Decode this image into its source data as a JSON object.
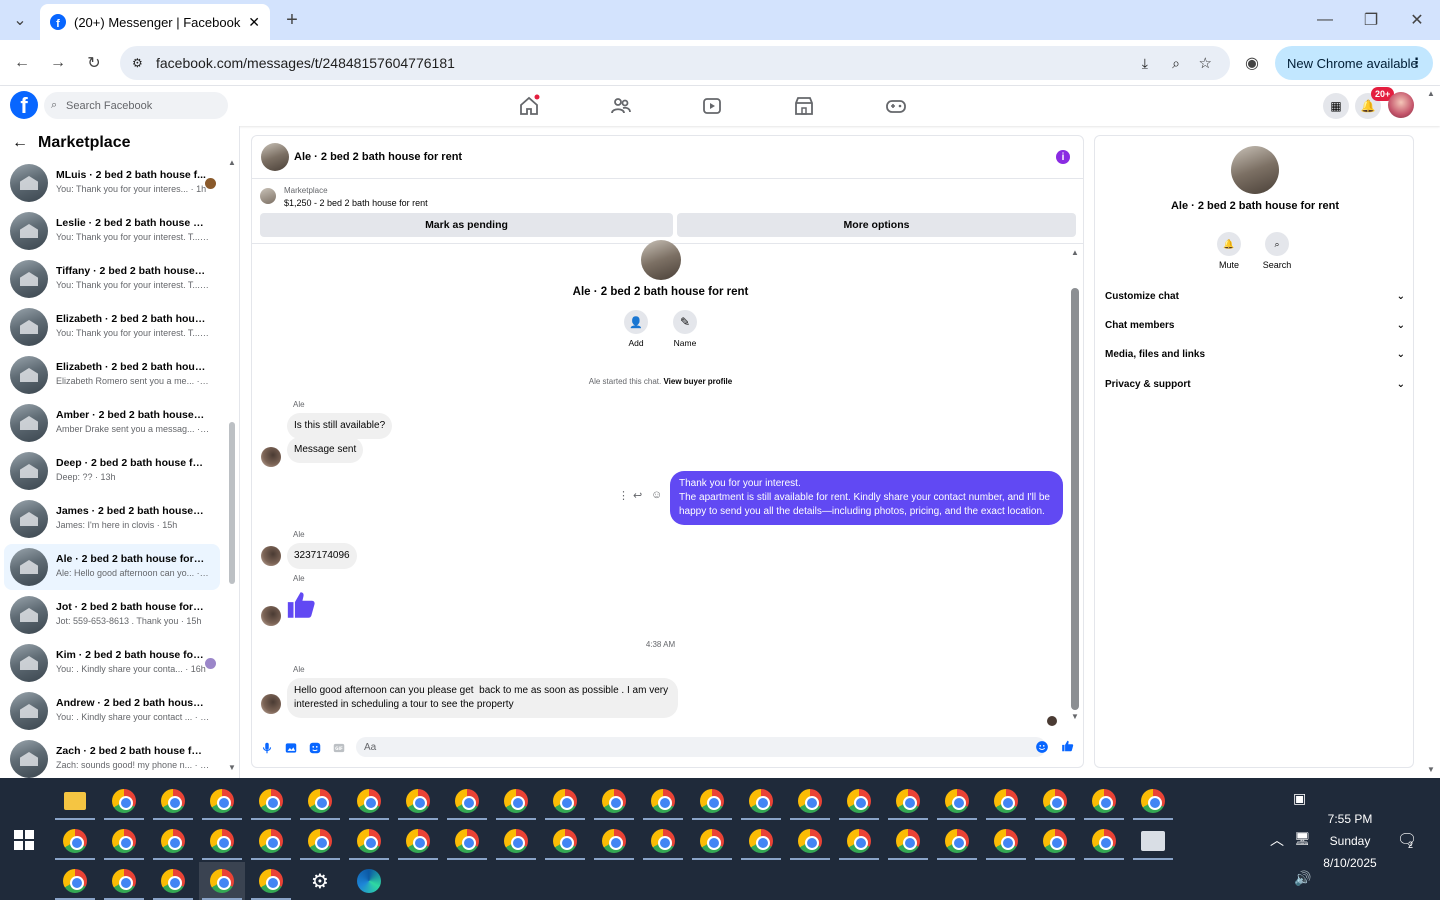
{
  "browser": {
    "tab_title": "(20+) Messenger | Facebook",
    "url": "facebook.com/messages/t/24848157604776181",
    "update_button": "New Chrome available"
  },
  "fb_header": {
    "search_placeholder": "Search Facebook",
    "notifications_badge": "20+",
    "brand_color": "#0866ff"
  },
  "sidebar": {
    "title": "Marketplace",
    "conversations": [
      {
        "name": "MLuis · 2 bed 2 bath house f...",
        "preview": "You: Thank you for your interes... · 1h",
        "active": false
      },
      {
        "name": "Leslie · 2 bed 2 bath house for ...",
        "preview": "You: Thank you for your interest. T... · 1h",
        "active": false
      },
      {
        "name": "Tiffany · 2 bed 2 bath house for...",
        "preview": "You: Thank you for your interest. T... · 1h",
        "active": false
      },
      {
        "name": "Elizabeth · 2 bed 2 bath house ...",
        "preview": "You: Thank you for your interest. T... · 1h",
        "active": false
      },
      {
        "name": "Elizabeth · 2 bed 2 bath house ...",
        "preview": "Elizabeth Romero sent you a me... · 11h",
        "active": false
      },
      {
        "name": "Amber · 2 bed 2 bath house for...",
        "preview": "Amber Drake sent you a messag... · 11h",
        "active": false
      },
      {
        "name": "Deep · 2 bed 2 bath house for r...",
        "preview": "Deep: ?? · 13h",
        "active": false
      },
      {
        "name": "James · 2 bed 2 bath house for ...",
        "preview": "James: I'm here in clovis · 15h",
        "active": false
      },
      {
        "name": "Ale · 2 bed 2 bath house for rent",
        "preview": "Ale: Hello good afternoon can yo... · 15h",
        "active": true
      },
      {
        "name": "Jot · 2 bed 2 bath house for rent",
        "preview": "Jot: 559-653-8613 . Thank you · 15h",
        "active": false
      },
      {
        "name": "Kim · 2 bed 2 bath house for ...",
        "preview": "You: . Kindly share your conta... · 16h",
        "active": false
      },
      {
        "name": "Andrew · 2 bed 2 bath house f...",
        "preview": "You: . Kindly share your contact ... · 16h",
        "active": false
      },
      {
        "name": "Zach · 2 bed 2 bath house for r...",
        "preview": "Zach: sounds good! my phone n... · 16h",
        "active": false
      }
    ]
  },
  "chat": {
    "title": "Ale · 2 bed 2 bath house for rent",
    "marketplace_label": "Marketplace",
    "listing": "$1,250 - 2 bed 2 bath house for rent",
    "mark_pending": "Mark as pending",
    "more_options": "More options",
    "intro_title": "Ale · 2 bed 2 bath house for rent",
    "add_label": "Add",
    "name_label": "Name",
    "started_text": "Ale started this chat.",
    "view_profile": "View buyer profile",
    "sender": "Ale",
    "msg1": "Is this still available?",
    "msg2": "Message sent",
    "out_line1": "Thank you for your interest.",
    "out_line2": "The apartment is still available for rent. Kindly share your contact number, and I'll be",
    "out_line3": "happy to send you all the details—including photos, pricing, and the exact location.",
    "msg3": "3237174096",
    "timestamp": "4:38 AM",
    "msg4_line1": "Hello good afternoon can you please get  back to me as soon as possible . I am very",
    "msg4_line2": "interested in scheduling a tour to see the property",
    "composer_placeholder": "Aa",
    "outgoing_color": "#6149f3"
  },
  "right_panel": {
    "title": "Ale · 2 bed 2 bath house for rent",
    "mute": "Mute",
    "search": "Search",
    "sections": [
      "Customize chat",
      "Chat members",
      "Media, files and links",
      "Privacy & support"
    ]
  },
  "taskbar": {
    "time": "7:55 PM",
    "day": "Sunday",
    "date": "8/10/2025",
    "notif_count": "2"
  }
}
